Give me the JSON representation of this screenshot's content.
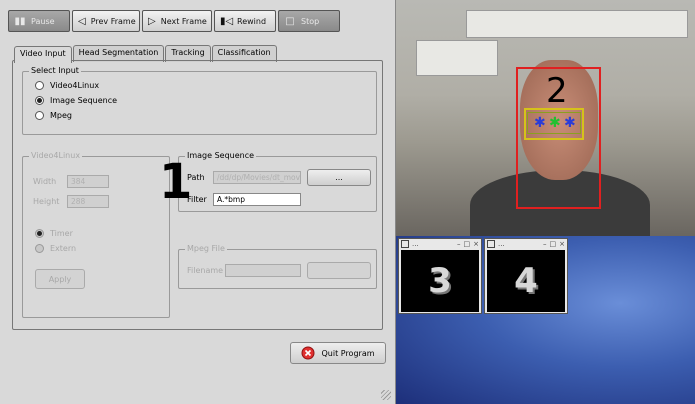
{
  "toolbar": {
    "pause": "Pause",
    "prev_frame": "Prev Frame",
    "next_frame": "Next Frame",
    "rewind": "Rewind",
    "stop": "Stop"
  },
  "tabs": [
    "Video Input",
    "Head Segmentation",
    "Tracking",
    "Classification"
  ],
  "select_input": {
    "title": "Select Input",
    "options": [
      "Video4Linux",
      "Image Sequence",
      "Mpeg"
    ],
    "selected": "Image Sequence"
  },
  "video4linux": {
    "title": "Video4Linux",
    "width_label": "Width",
    "width_value": "384",
    "height_label": "Height",
    "height_value": "288",
    "timer_label": "Timer",
    "extern_label": "Extern",
    "apply_label": "Apply"
  },
  "image_sequence": {
    "title": "Image Sequence",
    "path_label": "Path",
    "path_value": "/dd/dp/Movies/dt_mov",
    "browse_label": "...",
    "filter_label": "Filter",
    "filter_value": "A.*bmp"
  },
  "mpeg_file": {
    "title": "Mpeg File",
    "filename_label": "Filename"
  },
  "quit_label": "Quit Program",
  "annotations": {
    "one": "1",
    "two": "2",
    "three": "3",
    "four": "4"
  },
  "thumb_title": "...",
  "colors": {
    "face_box": "#e02020",
    "eye_box": "#d6c21a",
    "desktop": "#3c5eb0"
  }
}
